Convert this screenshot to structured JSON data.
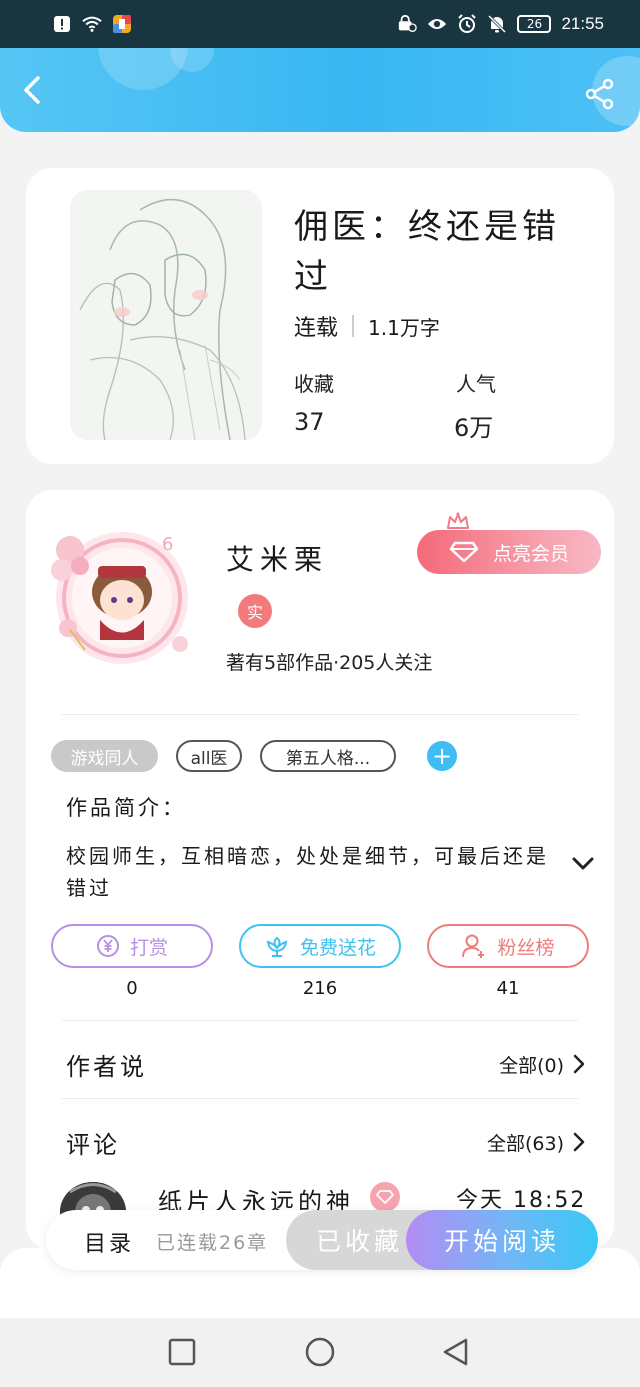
{
  "status_bar": {
    "time": "21:55",
    "battery": "26"
  },
  "book": {
    "title": "佣医：终还是错过",
    "status": "连载",
    "word_count": "1.1万字",
    "favorites_label": "收藏",
    "favorites_value": "37",
    "popularity_label": "人气",
    "popularity_value": "6万"
  },
  "author": {
    "name": "艾米栗",
    "badge": "实",
    "avatar_level": "6",
    "meta": "著有5部作品·205人关注",
    "vip_button": "点亮会员"
  },
  "tags": [
    "游戏同人",
    "all医",
    "第五人格..."
  ],
  "intro": {
    "title": "作品简介：",
    "text": "校园师生，互相暗恋，处处是细节，可最后还是错过"
  },
  "actions": [
    {
      "label": "打赏",
      "count": "0",
      "color": "#b690e6",
      "icon": "yen-coin-icon"
    },
    {
      "label": "免费送花",
      "count": "216",
      "color": "#3ec2f0",
      "icon": "flower-icon"
    },
    {
      "label": "粉丝榜",
      "count": "41",
      "color": "#f07b7b",
      "icon": "fan-person-icon"
    }
  ],
  "author_says": {
    "title": "作者说",
    "link": "全部(0)"
  },
  "comments": {
    "title": "评论",
    "link": "全部(63)",
    "first": {
      "name": "纸片人永远的神",
      "time": "今天 18:52"
    }
  },
  "bottom_bar": {
    "toc": "目录",
    "serial_count": "已连载26章",
    "favorited": "已收藏",
    "start_reading": "开始阅读"
  }
}
